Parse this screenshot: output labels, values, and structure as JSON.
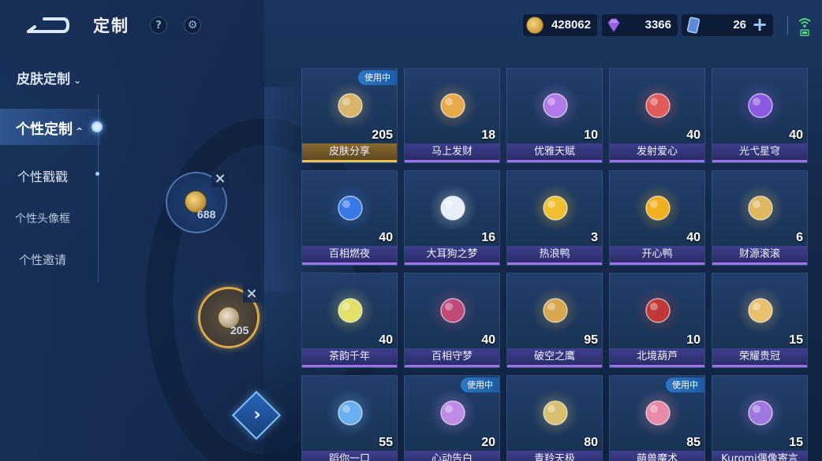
{
  "header": {
    "title": "定制",
    "help_icon_glyph": "?",
    "settings_icon_glyph": "⚙"
  },
  "currency": {
    "gold": "428062",
    "diamond": "3366",
    "ticket": "26",
    "add_glyph": "+"
  },
  "sidebar": {
    "category": "皮肤定制",
    "chevron_down": "⌄",
    "items": [
      {
        "label": "个性定制",
        "active": true
      },
      {
        "label": "个性戳戳"
      },
      {
        "label": "个性头像框"
      },
      {
        "label": "个性邀请"
      }
    ]
  },
  "slots": [
    {
      "count": "688",
      "icon": "gold-coin-icon"
    },
    {
      "count": "205",
      "icon": "skin-share-icon"
    }
  ],
  "confirm_glyph": "›",
  "grid": {
    "badge_label": "使用中",
    "items": [
      {
        "name": "皮肤分享",
        "count": "205",
        "badge": true,
        "gold": true,
        "color": "#d8b56a"
      },
      {
        "name": "马上发财",
        "count": "18",
        "badge": false,
        "color": "#e8a94a"
      },
      {
        "name": "优雅天赋",
        "count": "10",
        "badge": false,
        "color": "#b07ae8"
      },
      {
        "name": "发射爱心",
        "count": "40",
        "badge": false,
        "color": "#e05a5a"
      },
      {
        "name": "光弋星穹",
        "count": "40",
        "badge": false,
        "color": "#8a5ae0"
      },
      {
        "name": "百相燃夜",
        "count": "40",
        "badge": false,
        "color": "#3a7ae8"
      },
      {
        "name": "大耳狗之梦",
        "count": "16",
        "badge": false,
        "color": "#e8eef8"
      },
      {
        "name": "热浪鸭",
        "count": "3",
        "badge": false,
        "color": "#f0c030"
      },
      {
        "name": "开心鸭",
        "count": "40",
        "badge": false,
        "color": "#f0b020"
      },
      {
        "name": "财源滚滚",
        "count": "6",
        "badge": false,
        "color": "#e0b860"
      },
      {
        "name": "茶韵千年",
        "count": "40",
        "badge": false,
        "color": "#e0e06a"
      },
      {
        "name": "百相守梦",
        "count": "40",
        "badge": false,
        "color": "#c04a7a"
      },
      {
        "name": "破空之鹰",
        "count": "95",
        "badge": false,
        "color": "#d8a850"
      },
      {
        "name": "北境葫芦",
        "count": "10",
        "badge": false,
        "color": "#c03838"
      },
      {
        "name": "荣耀贵冠",
        "count": "15",
        "badge": false,
        "color": "#e8c070"
      },
      {
        "name": "蹈你一口",
        "count": "55",
        "badge": false,
        "color": "#6ab0f0"
      },
      {
        "name": "心动告白",
        "count": "20",
        "badge": true,
        "color": "#c08ae8"
      },
      {
        "name": "青羚天极",
        "count": "80",
        "badge": false,
        "color": "#d8c070"
      },
      {
        "name": "萌兽魔术",
        "count": "85",
        "badge": true,
        "color": "#e88aa8"
      },
      {
        "name": "Kuromi偶像寄言",
        "count": "15",
        "badge": false,
        "color": "#a078e0"
      }
    ]
  }
}
